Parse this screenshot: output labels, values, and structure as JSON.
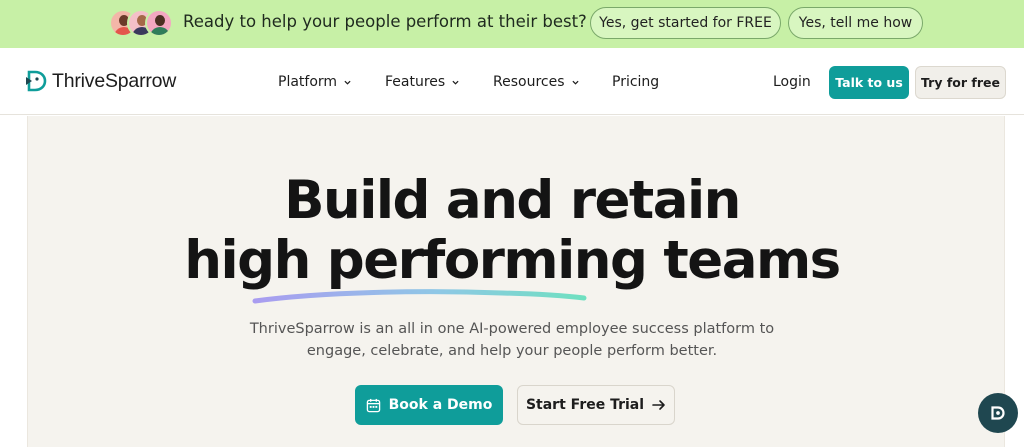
{
  "announcement": {
    "text": "Ready to help your people perform at their best?",
    "primary_button": "Yes, get started for FREE",
    "secondary_button": "Yes, tell me how"
  },
  "nav": {
    "brand": "ThriveSparrow",
    "items": [
      {
        "label": "Platform",
        "has_dropdown": true
      },
      {
        "label": "Features",
        "has_dropdown": true
      },
      {
        "label": "Resources",
        "has_dropdown": true
      },
      {
        "label": "Pricing",
        "has_dropdown": false
      }
    ],
    "login": "Login",
    "talk_button": "Talk to us",
    "try_button": "Try for free"
  },
  "hero": {
    "headline_line1": "Build and retain",
    "headline_line2": "high performing teams",
    "subtext_line1": "ThriveSparrow is an all in one AI-powered employee success platform to",
    "subtext_line2": "engage, celebrate, and help your people perform better.",
    "demo_button": "Book a Demo",
    "trial_button": "Start Free Trial"
  },
  "colors": {
    "accent": "#0f9d9a",
    "announcement_bg": "#c7f0a6",
    "hero_bg": "#f5f3ee",
    "chat_bubble": "#1f4750"
  },
  "icons": {
    "logo": "thrivesparrow-logo-icon",
    "dropdown": "chevron-down-icon",
    "demo": "calendar-icon",
    "trial": "arrow-right-icon",
    "chat": "chat-bubble-icon"
  }
}
